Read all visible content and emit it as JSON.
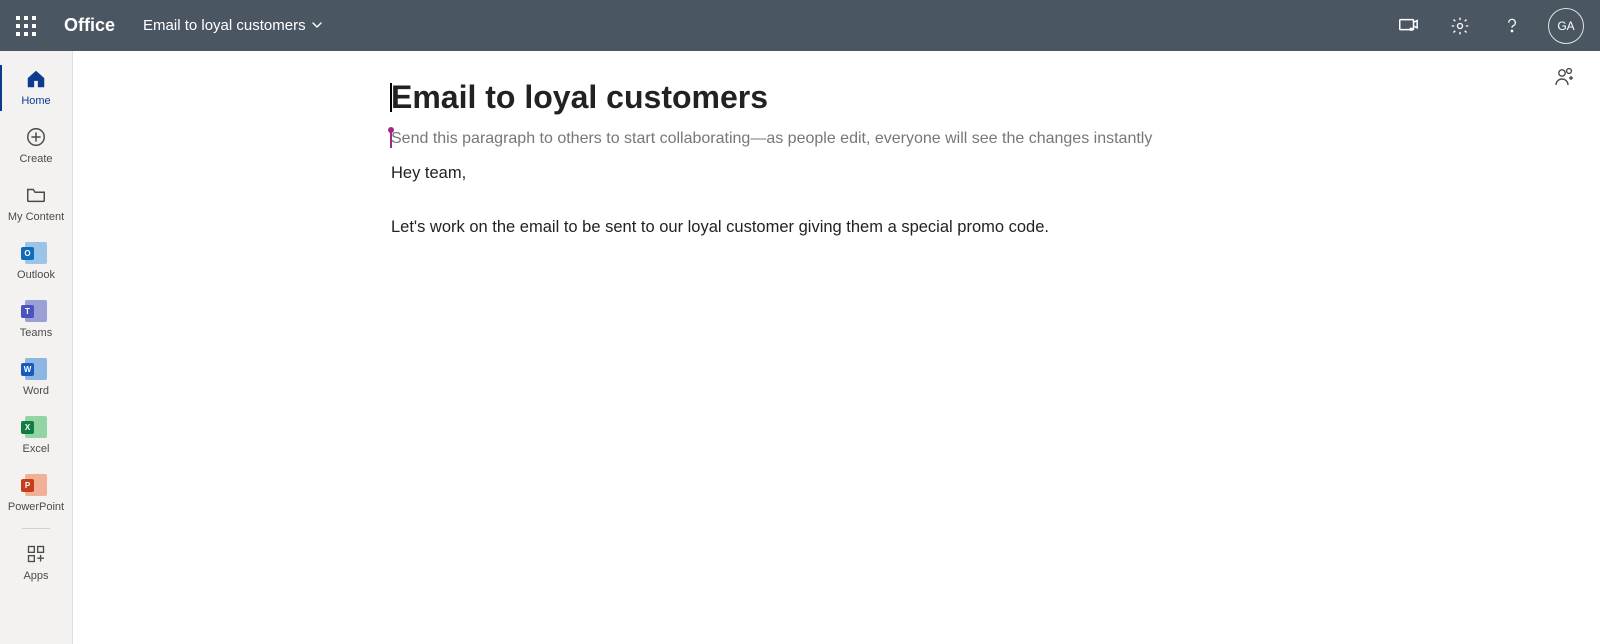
{
  "header": {
    "brand": "Office",
    "documentTitle": "Email to loyal customers",
    "avatarInitials": "GA"
  },
  "leftRail": {
    "items": {
      "home": "Home",
      "create": "Create",
      "mycontent": "My Content",
      "outlook": "Outlook",
      "teams": "Teams",
      "word": "Word",
      "excel": "Excel",
      "ppt": "PowerPoint",
      "apps": "Apps"
    }
  },
  "document": {
    "title": "Email to loyal customers",
    "collabHint": "Send this paragraph to others to start collaborating—as people edit, everyone will see the changes instantly",
    "paragraphs": {
      "p1": "Hey team,",
      "p2": "Let's work on the email to be sent to our loyal customer giving them a special promo code."
    }
  }
}
